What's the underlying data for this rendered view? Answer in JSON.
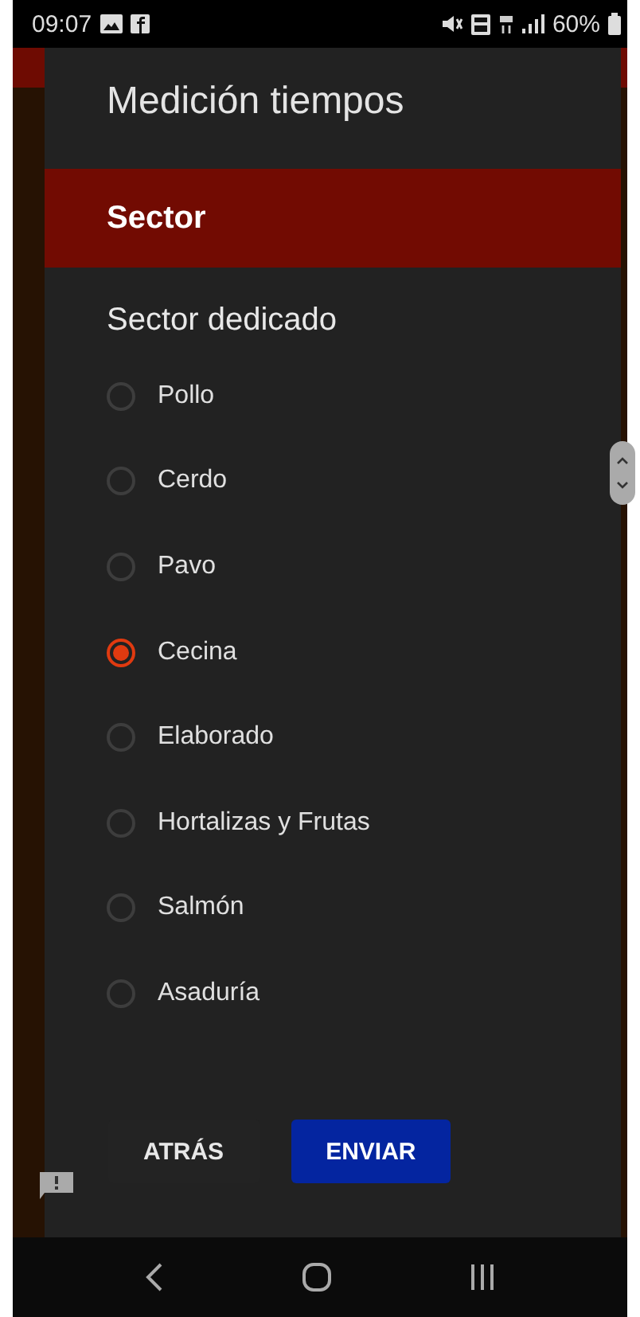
{
  "status_bar": {
    "time": "09:07",
    "battery": "60%"
  },
  "dialog": {
    "title": "Medición tiempos",
    "section": "Sector",
    "question": "Sector dedicado",
    "options": [
      {
        "label": "Pollo",
        "selected": false
      },
      {
        "label": "Cerdo",
        "selected": false
      },
      {
        "label": "Pavo",
        "selected": false
      },
      {
        "label": "Cecina",
        "selected": true
      },
      {
        "label": "Elaborado",
        "selected": false
      },
      {
        "label": "Hortalizas y Frutas",
        "selected": false
      },
      {
        "label": "Salmón",
        "selected": false
      },
      {
        "label": "Asaduría",
        "selected": false
      }
    ],
    "buttons": [
      {
        "label": "ATRÁS",
        "kind": "text"
      },
      {
        "label": "ENVIAR",
        "kind": "primary"
      }
    ]
  }
}
